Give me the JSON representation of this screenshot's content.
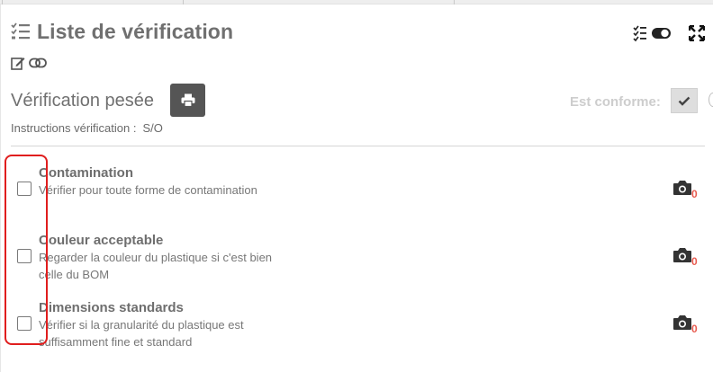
{
  "header": {
    "title": "Liste de vérification",
    "icons": {
      "title": "checklist-icon",
      "checklist_toggle": "checklist-toggle-icon",
      "expand": "expand-icon",
      "edit": "edit-icon",
      "link": "link-icon"
    }
  },
  "section": {
    "title": "Vérification pesée",
    "print_icon": "print-icon",
    "conforme_label": "Est conforme:",
    "conforme_checked": true,
    "instructions_label": "Instructions vérification :",
    "instructions_value": "S/O"
  },
  "items": [
    {
      "title": "Contamination",
      "description": "Vérifier pour toute forme de contamination",
      "checked": false,
      "photo_count": "0"
    },
    {
      "title": "Couleur acceptable",
      "description": "Regarder la couleur du plastique si c'est bien celle du BOM",
      "checked": false,
      "photo_count": "0"
    },
    {
      "title": "Dimensions standards",
      "description": "Vérifier si la granularité du plastique est suffisamment fine et standard",
      "checked": false,
      "photo_count": "0"
    }
  ],
  "colors": {
    "print_button": "#555555",
    "photo_count": "#e85a4f",
    "highlight": "#e01e1e"
  }
}
